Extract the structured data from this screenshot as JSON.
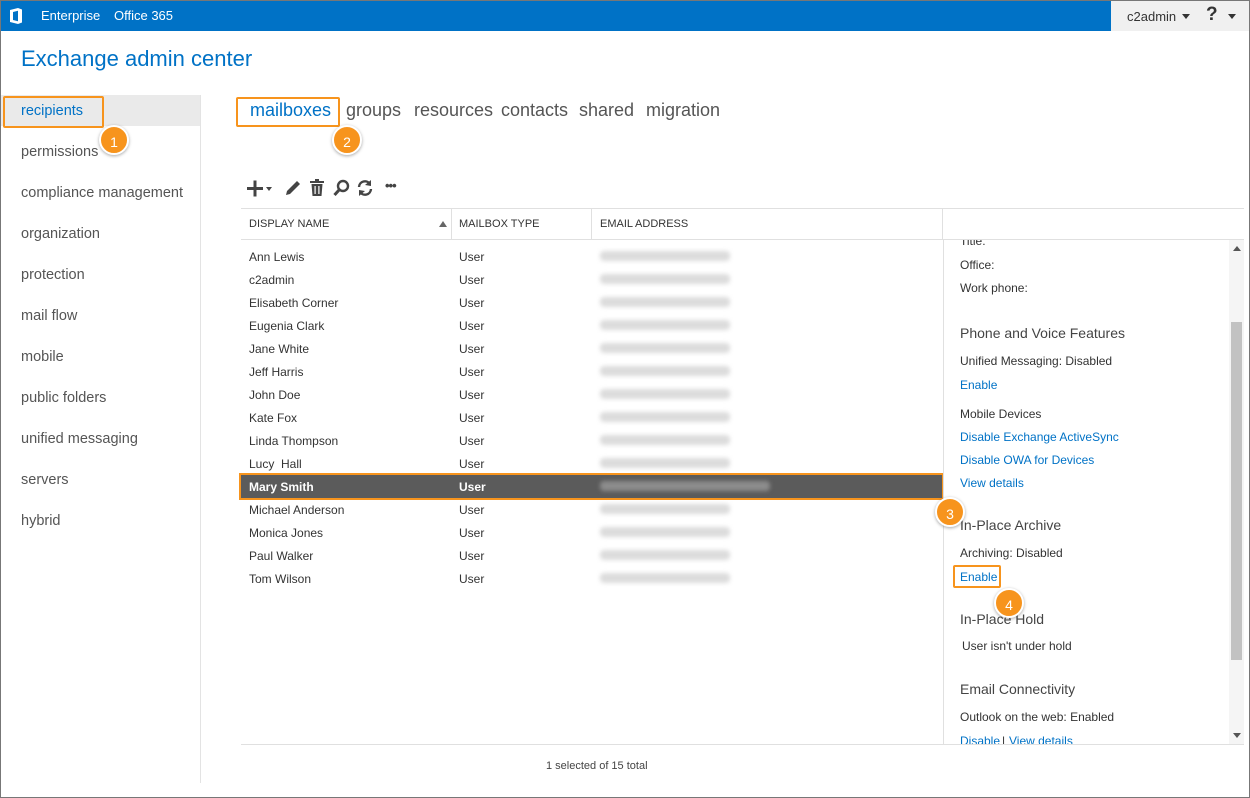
{
  "topbar": {
    "brand": "Enterprise",
    "product": "Office 365",
    "user": "c2admin",
    "help": "?"
  },
  "app_title": "Exchange admin center",
  "nav": [
    {
      "label": "recipients",
      "active": true
    },
    {
      "label": "permissions"
    },
    {
      "label": "compliance management"
    },
    {
      "label": "organization"
    },
    {
      "label": "protection"
    },
    {
      "label": "mail flow"
    },
    {
      "label": "mobile"
    },
    {
      "label": "public folders"
    },
    {
      "label": "unified messaging"
    },
    {
      "label": "servers"
    },
    {
      "label": "hybrid"
    }
  ],
  "tabs": [
    {
      "label": "mailboxes",
      "active": true
    },
    {
      "label": "groups"
    },
    {
      "label": "resources"
    },
    {
      "label": "contacts"
    },
    {
      "label": "shared"
    },
    {
      "label": "migration"
    }
  ],
  "toolbar": {
    "icons": [
      "add-icon",
      "edit-icon",
      "delete-icon",
      "search-icon",
      "refresh-icon",
      "more-icon"
    ],
    "more": "•••"
  },
  "columns": [
    "DISPLAY NAME",
    "MAILBOX TYPE",
    "EMAIL ADDRESS"
  ],
  "rows": [
    {
      "name": "Ann Lewis",
      "type": "User"
    },
    {
      "name": "c2admin",
      "type": "User"
    },
    {
      "name": "Elisabeth Corner",
      "type": "User"
    },
    {
      "name": "Eugenia Clark",
      "type": "User"
    },
    {
      "name": "Jane White",
      "type": "User"
    },
    {
      "name": "Jeff Harris",
      "type": "User"
    },
    {
      "name": "John Doe",
      "type": "User"
    },
    {
      "name": "Kate Fox",
      "type": "User"
    },
    {
      "name": "Linda Thompson",
      "type": "User"
    },
    {
      "name": "Lucy  Hall",
      "type": "User"
    },
    {
      "name": "Mary Smith",
      "type": "User",
      "selected": true
    },
    {
      "name": "Michael Anderson",
      "type": "User"
    },
    {
      "name": "Monica Jones",
      "type": "User"
    },
    {
      "name": "Paul Walker",
      "type": "User"
    },
    {
      "name": "Tom Wilson",
      "type": "User"
    }
  ],
  "details": {
    "title_label": "Title:",
    "office_label": "Office:",
    "work_phone_label": "Work phone:",
    "phone_voice_heading": "Phone and Voice Features",
    "unified_messaging": "Unified Messaging:  Disabled",
    "um_enable": "Enable",
    "mobile_devices": "Mobile Devices",
    "disable_activesync": "Disable Exchange ActiveSync",
    "disable_owa": "Disable OWA for Devices",
    "view_details": "View details",
    "archive_heading": "In-Place Archive",
    "archiving": "Archiving:  Disabled",
    "archive_enable": "Enable",
    "hold_heading": "In-Place Hold",
    "hold_status": "User isn't under hold",
    "email_heading": "Email Connectivity",
    "owa": "Outlook on the web:  Enabled",
    "owa_disable": "Disable",
    "owa_sep": "|",
    "owa_view": "View details"
  },
  "badges": [
    "1",
    "2",
    "3",
    "4"
  ],
  "status": "1 selected of 15 total",
  "colors": {
    "brand_blue": "#0072c6",
    "highlight_orange": "#f7941d",
    "selected_row": "#5b5b5b"
  }
}
